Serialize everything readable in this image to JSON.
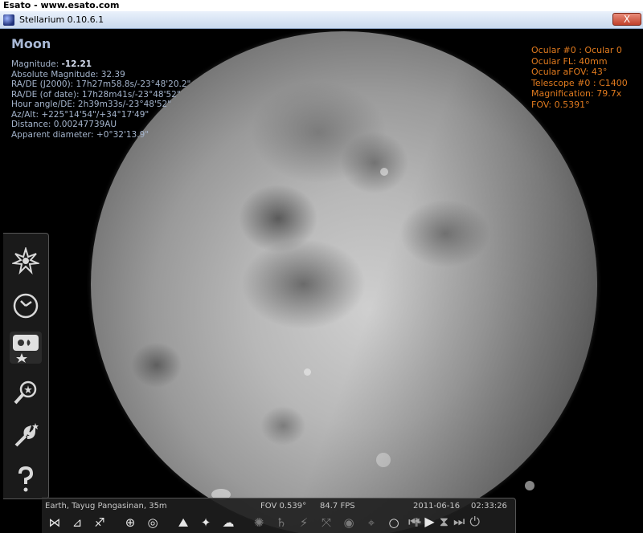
{
  "watermark": "Esato - www.esato.com",
  "window": {
    "title": "Stellarium 0.10.6.1",
    "close_glyph": "X"
  },
  "object_info": {
    "name": "Moon",
    "magnitude_label": "Magnitude: ",
    "magnitude_value": "-12.21",
    "rows": [
      "Absolute Magnitude: 32.39",
      "RA/DE (J2000): 17h27m58.8s/-23°48'20.2\"",
      "RA/DE (of date): 17h28m41s/-23°48'52\"",
      "Hour angle/DE: 2h39m33s/-23°48'52\"",
      "Az/Alt: +225°14'54\"/+34°17'49\"",
      "Distance: 0.00247739AU",
      "Apparent diameter: +0°32'13.9\""
    ]
  },
  "ocular_info": [
    "Ocular #0 : Ocular 0",
    "Ocular FL: 40mm",
    "Ocular aFOV: 43°",
    "Telescope #0 : C1400",
    "Magnification: 79.7x",
    "FOV: 0.5391°"
  ],
  "status_bar": {
    "location": "Earth, Tayug Pangasinan, 35m",
    "fov": "FOV 0.539°",
    "fps": "84.7 FPS",
    "date": "2011-06-16",
    "time": "02:33:26"
  },
  "left_toolbar": [
    {
      "icon": "sky-location-icon"
    },
    {
      "icon": "clock-icon"
    },
    {
      "icon": "sky-view-options-icon"
    },
    {
      "icon": "search-icon"
    },
    {
      "icon": "wrench-settings-icon"
    },
    {
      "icon": "help-icon"
    }
  ],
  "colors": {
    "ocular_text": "#e07a1e",
    "info_text": "#a4b4cc"
  }
}
